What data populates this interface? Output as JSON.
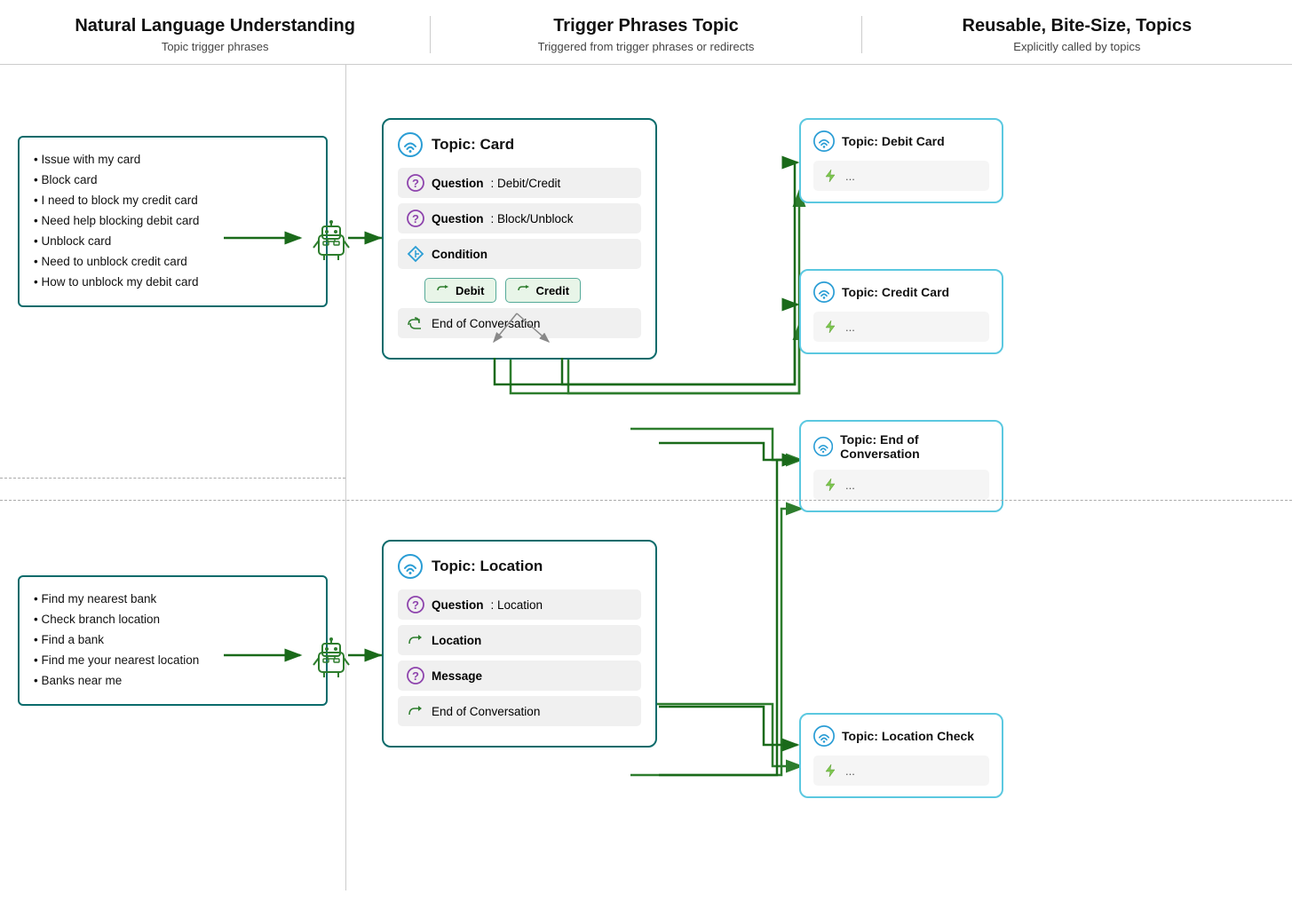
{
  "header": {
    "col1": {
      "title": "Natural Language Understanding",
      "sub": "Topic trigger phrases"
    },
    "col2": {
      "title": "Trigger Phrases Topic",
      "sub": "Triggered from trigger phrases or redirects"
    },
    "col3": {
      "title": "Reusable, Bite-Size, Topics",
      "sub": "Explicitly called by topics"
    }
  },
  "nlu_box1": {
    "phrases": [
      "• Issue with my card",
      "• Block card",
      "• I need to block my credit card",
      "• Need help blocking debit card",
      "• Unblock card",
      "• Need to unblock credit card",
      "• How to unblock my debit card"
    ]
  },
  "nlu_box2": {
    "phrases": [
      "• Find my nearest bank",
      "• Check branch location",
      "• Find a bank",
      "• Find me your nearest location",
      "• Banks near me"
    ]
  },
  "topic_card": {
    "title": "Topic: Card",
    "steps": [
      {
        "type": "question",
        "label": "Question",
        "detail": "Debit/Credit"
      },
      {
        "type": "question",
        "label": "Question",
        "detail": "Block/Unblock"
      },
      {
        "type": "condition",
        "label": "Condition",
        "detail": ""
      }
    ],
    "branches": [
      "Debit",
      "Credit"
    ],
    "end": "End of Conversation"
  },
  "topic_location": {
    "title": "Topic: Location",
    "steps": [
      {
        "type": "question",
        "label": "Question",
        "detail": "Location"
      },
      {
        "type": "redirect",
        "label": "Location",
        "detail": ""
      },
      {
        "type": "question",
        "label": "Message",
        "detail": ""
      },
      {
        "type": "end",
        "label": "End of Conversation",
        "detail": ""
      }
    ]
  },
  "reusable": {
    "debit_card": {
      "title": "Topic: Debit Card",
      "content": "..."
    },
    "credit_card": {
      "title": "Topic: Credit Card",
      "content": "..."
    },
    "end_conv": {
      "title": "Topic: End of Conversation",
      "content": "..."
    },
    "location_check": {
      "title": "Topic: Location Check",
      "content": "..."
    }
  }
}
